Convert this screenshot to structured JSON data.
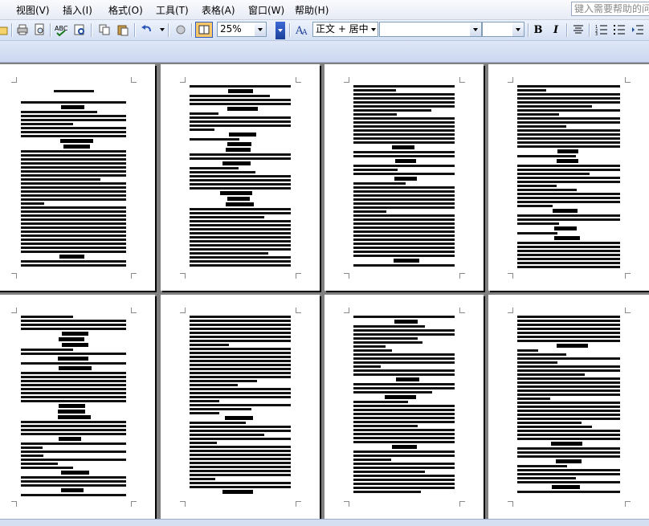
{
  "menubar": {
    "items": [
      {
        "label": "视图(V)",
        "name": "menu-view"
      },
      {
        "label": "插入(I)",
        "name": "menu-insert"
      },
      {
        "label": "格式(O)",
        "name": "menu-format"
      },
      {
        "label": "工具(T)",
        "name": "menu-tools"
      },
      {
        "label": "表格(A)",
        "name": "menu-table"
      },
      {
        "label": "窗口(W)",
        "name": "menu-window"
      },
      {
        "label": "帮助(H)",
        "name": "menu-help"
      }
    ],
    "help_search_placeholder": "键入需要帮助的问题"
  },
  "toolbar": {
    "zoom_value": "25%",
    "style_value": "正文 + 居中",
    "bold_label": "B",
    "italic_label": "I",
    "icons": [
      "open-icon",
      "print-icon",
      "print-preview-icon",
      "spelling-icon",
      "copy-icon",
      "paste-icon",
      "undo-icon",
      "drawing-icon",
      "reading-layout-icon",
      "styles-formatting-icon",
      "align-center-icon",
      "numbering-icon",
      "bullets-icon",
      "decrease-indent-icon"
    ]
  },
  "document": {
    "page_count_visible": 8,
    "first_page_title": "2013年度学生综合素质"
  },
  "colors": {
    "menubar_bg": "#e6ebf5",
    "toolbar_bg": "#d3dff3",
    "workspace_bg": "#808080",
    "page_bg": "#ffffff"
  }
}
